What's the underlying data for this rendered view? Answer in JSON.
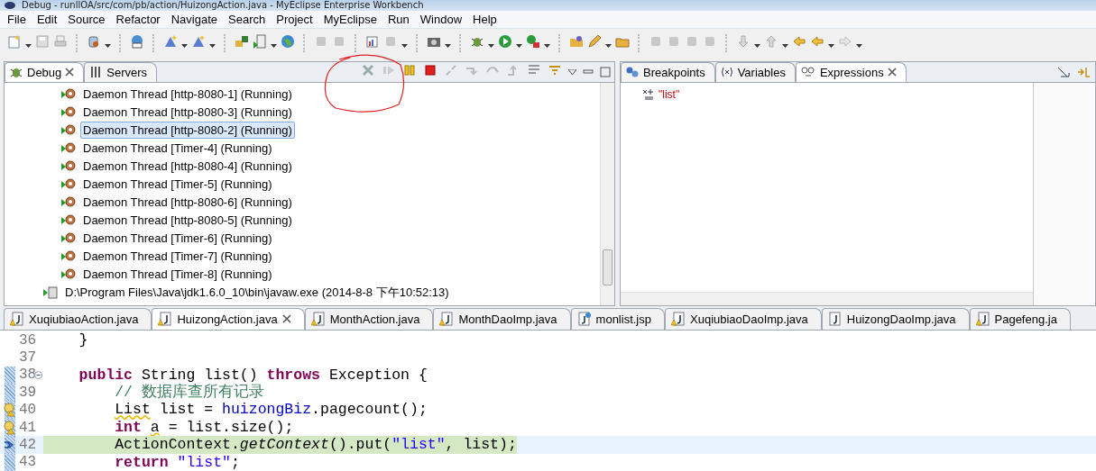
{
  "window": {
    "title": "Debug - runllOA/src/com/pb/action/HuizongAction.java - MyEclipse Enterprise Workbench"
  },
  "menu": [
    "File",
    "Edit",
    "Source",
    "Refactor",
    "Navigate",
    "Search",
    "Project",
    "MyEclipse",
    "Run",
    "Window",
    "Help"
  ],
  "debug_view": {
    "tabs": [
      {
        "label": "Debug",
        "selected": true
      },
      {
        "label": "Servers",
        "selected": false
      }
    ],
    "tree": [
      {
        "kind": "thread",
        "label": "Daemon Thread [http-8080-1] (Running)",
        "selected": false
      },
      {
        "kind": "thread",
        "label": "Daemon Thread [http-8080-3] (Running)",
        "selected": false
      },
      {
        "kind": "thread",
        "label": "Daemon Thread [http-8080-2] (Running)",
        "selected": true
      },
      {
        "kind": "thread",
        "label": "Daemon Thread [Timer-4] (Running)",
        "selected": false
      },
      {
        "kind": "thread",
        "label": "Daemon Thread [http-8080-4] (Running)",
        "selected": false
      },
      {
        "kind": "thread",
        "label": "Daemon Thread [Timer-5] (Running)",
        "selected": false
      },
      {
        "kind": "thread",
        "label": "Daemon Thread [http-8080-6] (Running)",
        "selected": false
      },
      {
        "kind": "thread",
        "label": "Daemon Thread [http-8080-5] (Running)",
        "selected": false
      },
      {
        "kind": "thread",
        "label": "Daemon Thread [Timer-6] (Running)",
        "selected": false
      },
      {
        "kind": "thread",
        "label": "Daemon Thread [Timer-7] (Running)",
        "selected": false
      },
      {
        "kind": "thread",
        "label": "Daemon Thread [Timer-8] (Running)",
        "selected": false
      },
      {
        "kind": "process",
        "label": "D:\\Program Files\\Java\\jdk1.6.0_10\\bin\\javaw.exe (2014-8-8 下午10:52:13)",
        "selected": false
      }
    ]
  },
  "expressions_view": {
    "tabs": [
      {
        "label": "Breakpoints",
        "selected": false
      },
      {
        "label": "Variables",
        "selected": false
      },
      {
        "label": "Expressions",
        "selected": true
      }
    ],
    "expressions": [
      {
        "label": "\"list\""
      }
    ]
  },
  "editor": {
    "tabs": [
      {
        "label": "XuqiubiaoAction.java",
        "kind": "java_warning",
        "selected": false
      },
      {
        "label": "HuizongAction.java",
        "kind": "java_warning",
        "selected": true
      },
      {
        "label": "MonthAction.java",
        "kind": "java_warning",
        "selected": false
      },
      {
        "label": "MonthDaoImp.java",
        "kind": "java_warning",
        "selected": false
      },
      {
        "label": "monlist.jsp",
        "kind": "jsp",
        "selected": false
      },
      {
        "label": "XuqiubiaoDaoImp.java",
        "kind": "java_warning",
        "selected": false
      },
      {
        "label": "HuizongDaoImp.java",
        "kind": "java",
        "selected": false
      },
      {
        "label": "Pagefeng.ja",
        "kind": "java_warning",
        "selected": false
      }
    ],
    "lines": [
      {
        "number": "36",
        "collapsible": false,
        "warning": false,
        "instruction_pointer": false,
        "in_range": false,
        "current": false,
        "tokens": [
          {
            "t": "    }",
            "kind": "plain",
            "warn": false
          }
        ]
      },
      {
        "number": "37",
        "collapsible": false,
        "warning": false,
        "instruction_pointer": false,
        "in_range": false,
        "current": false
      },
      {
        "number": "38",
        "collapsible": true,
        "warning": false,
        "instruction_pointer": false,
        "in_range": true,
        "current": false,
        "tokens": [
          {
            "t": "    public",
            "kind": "keyword",
            "warn": false
          },
          {
            "t": " String list() ",
            "kind": "plain",
            "warn": false
          },
          {
            "t": "throws",
            "kind": "keyword",
            "warn": false
          },
          {
            "t": " Exception {",
            "kind": "plain",
            "warn": false
          }
        ]
      },
      {
        "number": "39",
        "collapsible": false,
        "warning": false,
        "instruction_pointer": false,
        "in_range": true,
        "current": false,
        "tokens": [
          {
            "t": "        // 数据库查所有记录",
            "kind": "comment",
            "warn": false
          }
        ]
      },
      {
        "number": "40",
        "collapsible": false,
        "warning": true,
        "instruction_pointer": false,
        "in_range": true,
        "current": false,
        "tokens": [
          {
            "t": "        List",
            "kind": "plain",
            "warn": true
          },
          {
            "t": " list = ",
            "kind": "plain",
            "warn": false
          },
          {
            "t": "huizongBiz",
            "kind": "field",
            "warn": false
          },
          {
            "t": ".pagecount();",
            "kind": "plain",
            "warn": false
          }
        ]
      },
      {
        "number": "41",
        "collapsible": false,
        "warning": true,
        "instruction_pointer": false,
        "in_range": true,
        "current": false,
        "tokens": [
          {
            "t": "        int",
            "kind": "keyword",
            "warn": false
          },
          {
            "t": " a",
            "kind": "plain",
            "warn": true
          },
          {
            "t": " = list.size();",
            "kind": "plain",
            "warn": false
          }
        ]
      },
      {
        "number": "42",
        "collapsible": false,
        "warning": false,
        "instruction_pointer": true,
        "in_range": true,
        "current": true,
        "tokens": [
          {
            "t": "        ActionContext.",
            "kind": "plain",
            "warn": false
          },
          {
            "t": "getContext",
            "kind": "method",
            "warn": false
          },
          {
            "t": "().put(",
            "kind": "plain",
            "warn": false
          },
          {
            "t": "\"list\"",
            "kind": "string",
            "warn": false
          },
          {
            "t": ", list);",
            "kind": "plain",
            "warn": false
          }
        ]
      },
      {
        "number": "43",
        "collapsible": false,
        "warning": false,
        "instruction_pointer": false,
        "in_range": true,
        "current": false,
        "tokens": [
          {
            "t": "        return",
            "kind": "keyword",
            "warn": false
          },
          {
            "t": " \"list\"",
            "kind": "string",
            "warn": false
          },
          {
            "t": ";",
            "kind": "plain",
            "warn": false
          }
        ]
      }
    ]
  }
}
